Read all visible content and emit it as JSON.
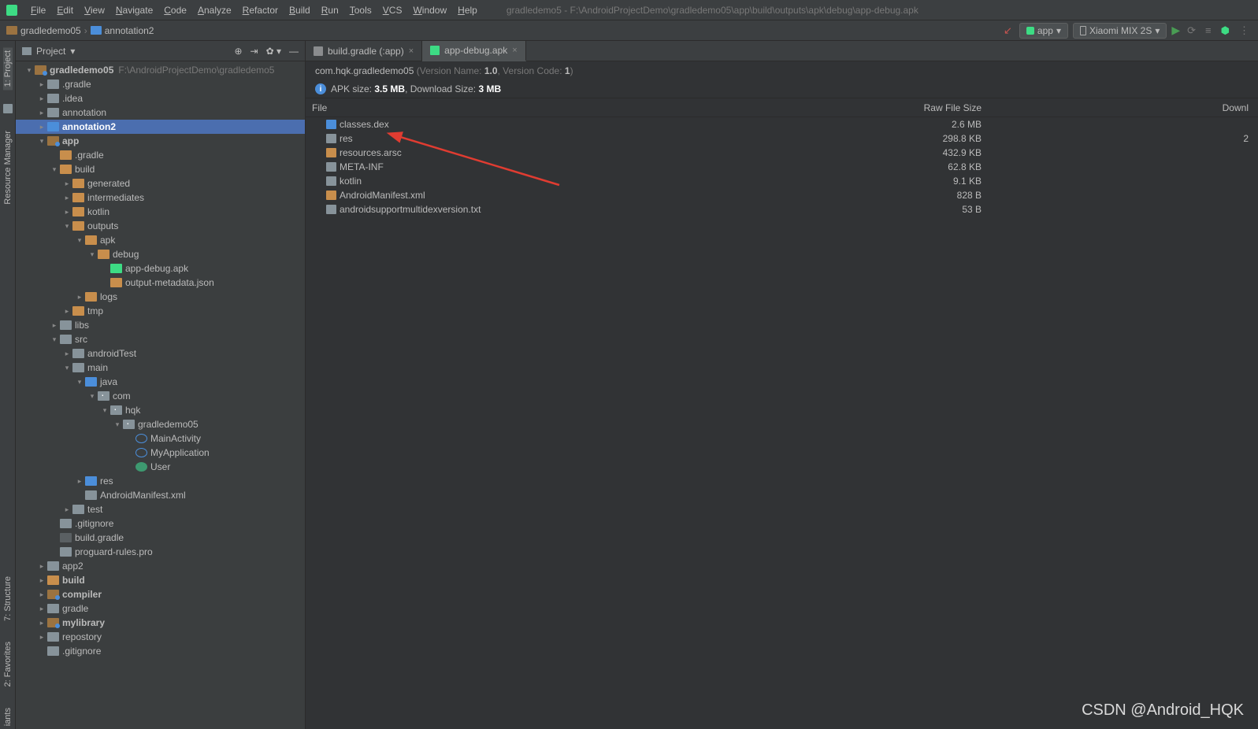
{
  "window": {
    "title_path": "gradledemo5 - F:\\AndroidProjectDemo\\gradledemo05\\app\\build\\outputs\\apk\\debug\\app-debug.apk"
  },
  "menubar": [
    "File",
    "Edit",
    "View",
    "Navigate",
    "Code",
    "Analyze",
    "Refactor",
    "Build",
    "Run",
    "Tools",
    "VCS",
    "Window",
    "Help"
  ],
  "breadcrumb": {
    "root": "gradledemo05",
    "leaf": "annotation2"
  },
  "toolbar": {
    "config": "app",
    "device": "Xiaomi MIX 2S"
  },
  "left_tabs": [
    "1: Project",
    "Resource Manager",
    "7: Structure",
    "2: Favorites",
    "iants"
  ],
  "project_panel": {
    "title": "Project"
  },
  "tree": [
    {
      "d": 0,
      "a": "down",
      "i": "i-mod",
      "l": "gradledemo05",
      "h": "F:\\AndroidProjectDemo\\gradledemo5",
      "b": 1
    },
    {
      "d": 1,
      "a": "right",
      "i": "i-dir",
      "l": ".gradle"
    },
    {
      "d": 1,
      "a": "right",
      "i": "i-dir",
      "l": ".idea"
    },
    {
      "d": 1,
      "a": "right",
      "i": "i-dir",
      "l": "annotation"
    },
    {
      "d": 1,
      "a": "right",
      "i": "i-dir-b",
      "l": "annotation2",
      "sel": 1,
      "b": 1
    },
    {
      "d": 1,
      "a": "down",
      "i": "i-mod",
      "l": "app",
      "b": 1
    },
    {
      "d": 2,
      "a": "none",
      "i": "i-dir-o",
      "l": ".gradle"
    },
    {
      "d": 2,
      "a": "down",
      "i": "i-dir-o",
      "l": "build"
    },
    {
      "d": 3,
      "a": "right",
      "i": "i-dir-o",
      "l": "generated"
    },
    {
      "d": 3,
      "a": "right",
      "i": "i-dir-o",
      "l": "intermediates"
    },
    {
      "d": 3,
      "a": "right",
      "i": "i-dir-o",
      "l": "kotlin"
    },
    {
      "d": 3,
      "a": "down",
      "i": "i-dir-o",
      "l": "outputs"
    },
    {
      "d": 4,
      "a": "down",
      "i": "i-dir-o",
      "l": "apk"
    },
    {
      "d": 5,
      "a": "down",
      "i": "i-dir-o",
      "l": "debug"
    },
    {
      "d": 6,
      "a": "none",
      "i": "i-apk",
      "l": "app-debug.apk"
    },
    {
      "d": 6,
      "a": "none",
      "i": "i-json",
      "l": "output-metadata.json"
    },
    {
      "d": 4,
      "a": "right",
      "i": "i-dir-o",
      "l": "logs"
    },
    {
      "d": 3,
      "a": "right",
      "i": "i-dir-o",
      "l": "tmp"
    },
    {
      "d": 2,
      "a": "right",
      "i": "i-dir",
      "l": "libs"
    },
    {
      "d": 2,
      "a": "down",
      "i": "i-dir",
      "l": "src"
    },
    {
      "d": 3,
      "a": "right",
      "i": "i-dir",
      "l": "androidTest"
    },
    {
      "d": 3,
      "a": "down",
      "i": "i-dir",
      "l": "main"
    },
    {
      "d": 4,
      "a": "down",
      "i": "i-dir-b",
      "l": "java"
    },
    {
      "d": 5,
      "a": "down",
      "i": "i-pkg",
      "l": "com"
    },
    {
      "d": 6,
      "a": "down",
      "i": "i-pkg",
      "l": "hqk"
    },
    {
      "d": 7,
      "a": "down",
      "i": "i-pkg",
      "l": "gradledemo05"
    },
    {
      "d": 8,
      "a": "none",
      "i": "i-class",
      "l": "MainActivity"
    },
    {
      "d": 8,
      "a": "none",
      "i": "i-class",
      "l": "MyApplication"
    },
    {
      "d": 8,
      "a": "none",
      "i": "i-class-c",
      "l": "User"
    },
    {
      "d": 4,
      "a": "right",
      "i": "i-dir-b",
      "l": "res"
    },
    {
      "d": 4,
      "a": "none",
      "i": "i-file",
      "l": "AndroidManifest.xml"
    },
    {
      "d": 3,
      "a": "right",
      "i": "i-dir",
      "l": "test"
    },
    {
      "d": 2,
      "a": "none",
      "i": "i-file",
      "l": ".gitignore"
    },
    {
      "d": 2,
      "a": "none",
      "i": "i-gradle",
      "l": "build.gradle"
    },
    {
      "d": 2,
      "a": "none",
      "i": "i-file",
      "l": "proguard-rules.pro"
    },
    {
      "d": 1,
      "a": "right",
      "i": "i-dir",
      "l": "app2"
    },
    {
      "d": 1,
      "a": "right",
      "i": "i-dir-o",
      "l": "build",
      "b": 1
    },
    {
      "d": 1,
      "a": "right",
      "i": "i-mod",
      "l": "compiler",
      "b": 1
    },
    {
      "d": 1,
      "a": "right",
      "i": "i-dir",
      "l": "gradle"
    },
    {
      "d": 1,
      "a": "right",
      "i": "i-mod",
      "l": "mylibrary",
      "b": 1
    },
    {
      "d": 1,
      "a": "right",
      "i": "i-dir",
      "l": "repostory"
    },
    {
      "d": 1,
      "a": "none",
      "i": "i-file",
      "l": ".gitignore"
    }
  ],
  "tabs": [
    {
      "label": "build.gradle (:app)",
      "icon": "ti-gradle",
      "active": false
    },
    {
      "label": "app-debug.apk",
      "icon": "ti-apk",
      "active": true
    }
  ],
  "apk": {
    "package": "com.hqk.gradledemo05",
    "version_name_label": "Version Name:",
    "version_name": "1.0",
    "version_code_label": "Version Code:",
    "version_code": "1",
    "info_prefix": "APK size:",
    "apk_size": "3.5 MB",
    "dl_label": "Download Size:",
    "dl_size": "3 MB"
  },
  "ft_head": {
    "c1": "File",
    "c2": "Raw File Size",
    "c3": "Downl"
  },
  "ft_rows": [
    {
      "a": "none",
      "i": "dex",
      "n": "classes.dex",
      "s": "2.6 MB",
      "d": ""
    },
    {
      "a": "right",
      "i": "dir",
      "n": "res",
      "s": "298.8 KB",
      "d": "2"
    },
    {
      "a": "none",
      "i": "arsc",
      "n": "resources.arsc",
      "s": "432.9 KB",
      "d": ""
    },
    {
      "a": "right",
      "i": "dir",
      "n": "META-INF",
      "s": "62.8 KB",
      "d": ""
    },
    {
      "a": "right",
      "i": "dir",
      "n": "kotlin",
      "s": "9.1 KB",
      "d": ""
    },
    {
      "a": "none",
      "i": "xml",
      "n": "AndroidManifest.xml",
      "s": "828 B",
      "d": ""
    },
    {
      "a": "none",
      "i": "txt",
      "n": "androidsupportmultidexversion.txt",
      "s": "53 B",
      "d": ""
    }
  ],
  "watermark": "CSDN @Android_HQK"
}
